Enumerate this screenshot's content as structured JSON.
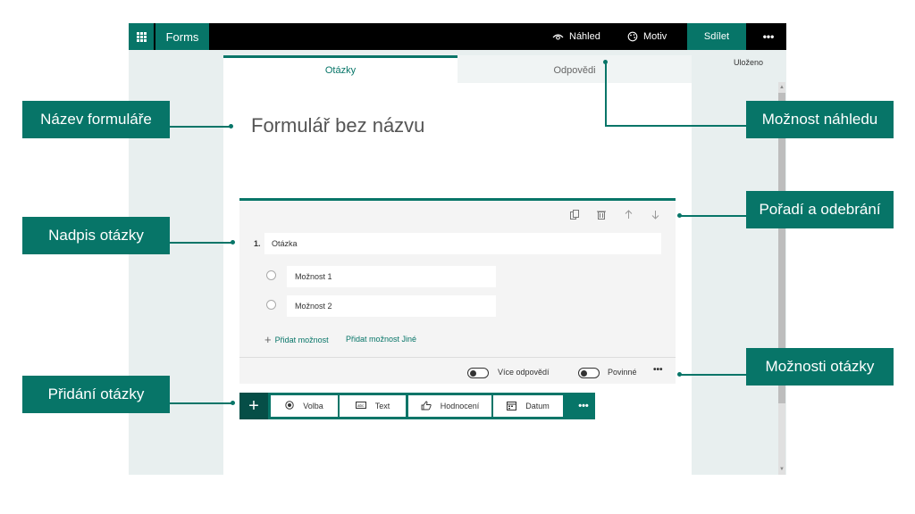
{
  "app": {
    "name": "Forms",
    "preview_label": "Náhled",
    "theme_label": "Motiv",
    "share_label": "Sdílet",
    "more_label": "•••",
    "saved_status": "Uloženo",
    "accent_color": "#077568"
  },
  "tabs": [
    {
      "label": "Otázky",
      "active": true
    },
    {
      "label": "Odpovědi",
      "active": false
    }
  ],
  "form": {
    "title": "Formulář bez názvu",
    "question": {
      "number": "1.",
      "title": "Otázka",
      "options": [
        "Možnost 1",
        "Možnost 2"
      ],
      "add_option": "Přidat možnost",
      "add_other": "Přidat možnost Jiné",
      "multiple_answers": "Více odpovědí",
      "required": "Povinné",
      "more": "•••"
    }
  },
  "add_bar": {
    "plus": "+",
    "types": [
      {
        "label": "Volba",
        "icon": "radio-icon"
      },
      {
        "label": "Text",
        "icon": "text-icon"
      },
      {
        "label": "Hodnocení",
        "icon": "thumb-icon"
      },
      {
        "label": "Datum",
        "icon": "calendar-icon"
      }
    ],
    "more": "•••"
  },
  "callouts": {
    "form_name": "Název formuláře",
    "question_heading": "Nadpis otázky",
    "add_question": "Přidání otázky",
    "preview_option": "Možnost náhledu",
    "order_remove": "Pořadí a odebrání",
    "question_options": "Možnosti otázky"
  }
}
